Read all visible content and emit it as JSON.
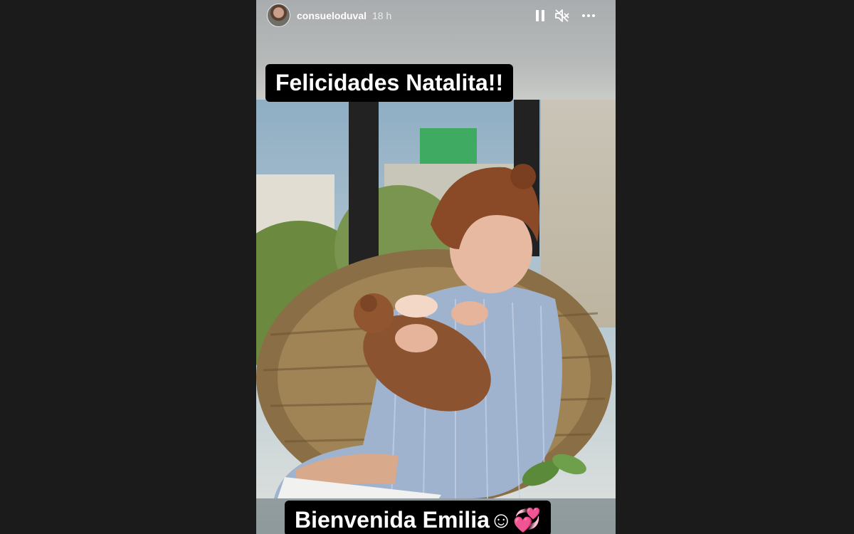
{
  "story": {
    "username": "consueloduval",
    "time": "18 h",
    "caption_top": "Felicidades Natalita!!",
    "caption_bottom": "Bienvenida Emilia☺💞"
  },
  "icons": {
    "pause": "pause-icon",
    "mute": "muted-speaker-icon",
    "more": "more-options-icon"
  }
}
